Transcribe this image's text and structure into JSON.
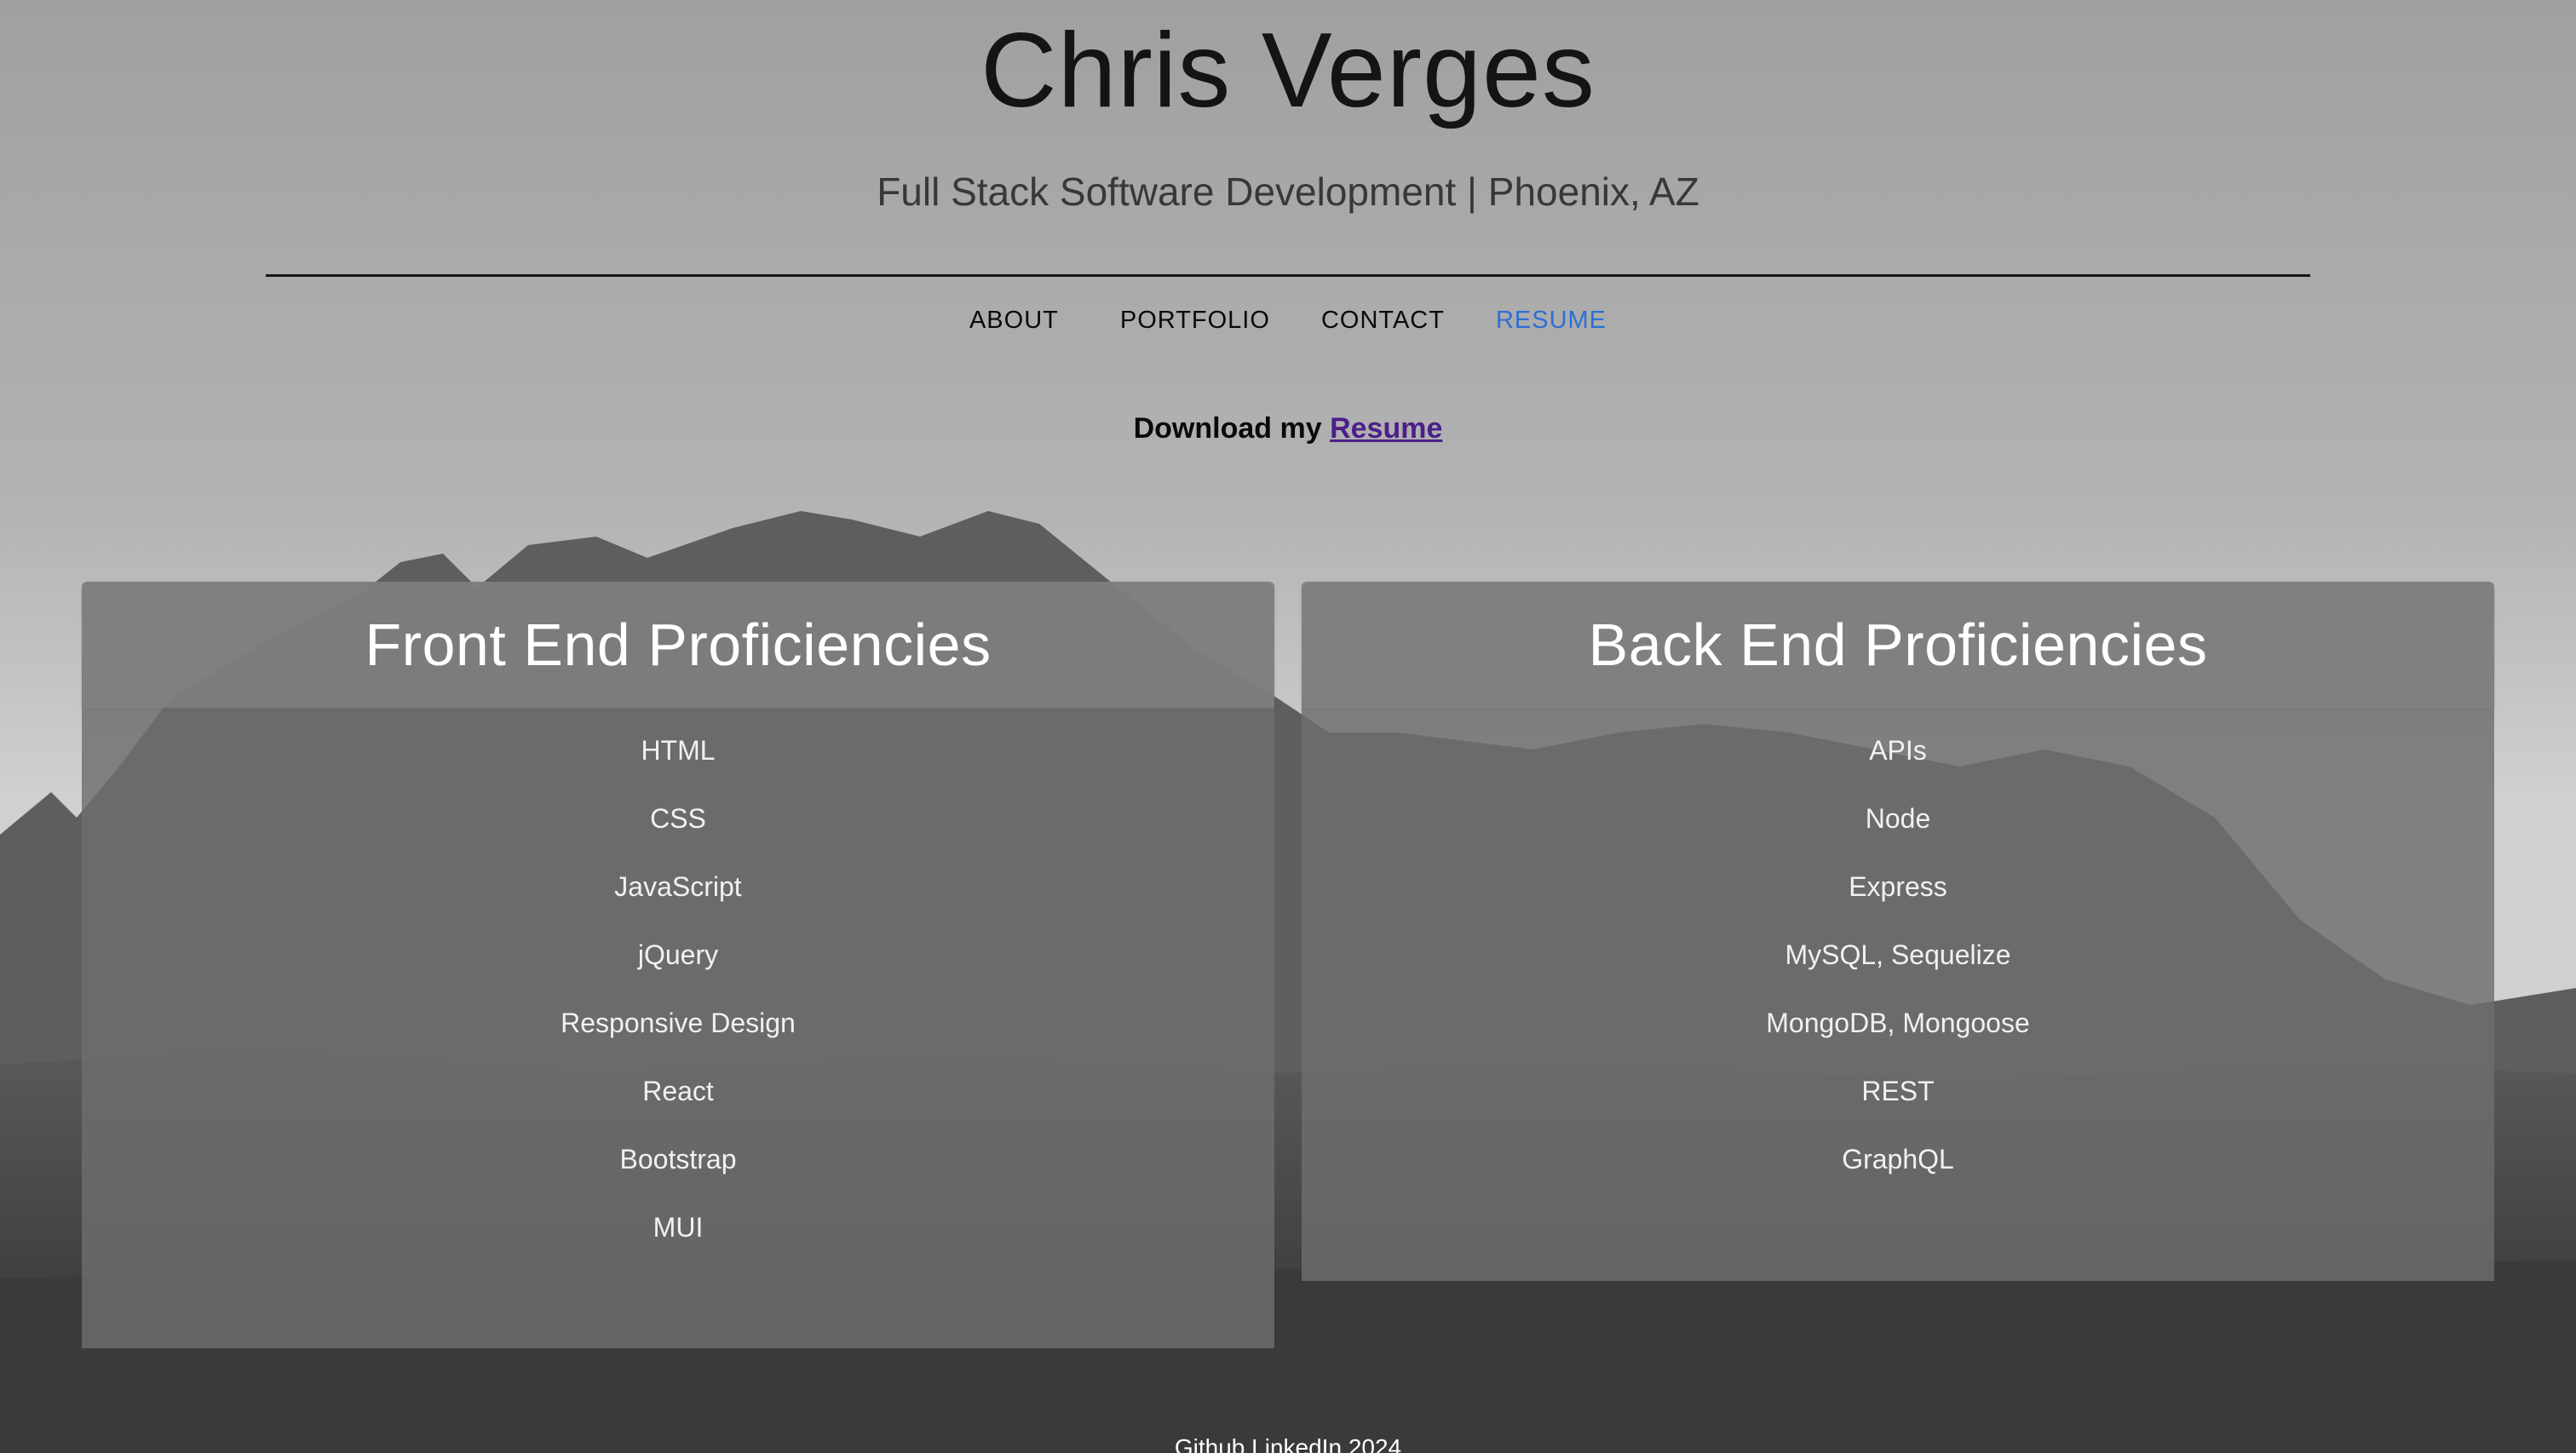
{
  "header": {
    "title": "Chris Verges",
    "subtitle": "Full Stack Software Development | Phoenix, AZ"
  },
  "nav": {
    "items": [
      {
        "label": "ABOUT"
      },
      {
        "label": "PORTFOLIO"
      },
      {
        "label": "CONTACT"
      },
      {
        "label": "RESUME",
        "active": true
      }
    ],
    "active_color": "#2b6fd6"
  },
  "download": {
    "prefix": "Download my",
    "link_label": "Resume",
    "link_color": "#4b1f8a"
  },
  "front_end": {
    "title": "Front End Proficiencies",
    "items": [
      "HTML",
      "CSS",
      "JavaScript",
      "jQuery",
      "Responsive Design",
      "React",
      "Bootstrap",
      "MUI"
    ]
  },
  "back_end": {
    "title": "Back End Proficiencies",
    "items": [
      "APIs",
      "Node",
      "Express",
      "MySQL, Sequelize",
      "MongoDB, Mongoose",
      "REST",
      "GraphQL"
    ]
  },
  "footer": {
    "github": "Github",
    "linkedin": "LinkedIn",
    "year": "2024"
  }
}
